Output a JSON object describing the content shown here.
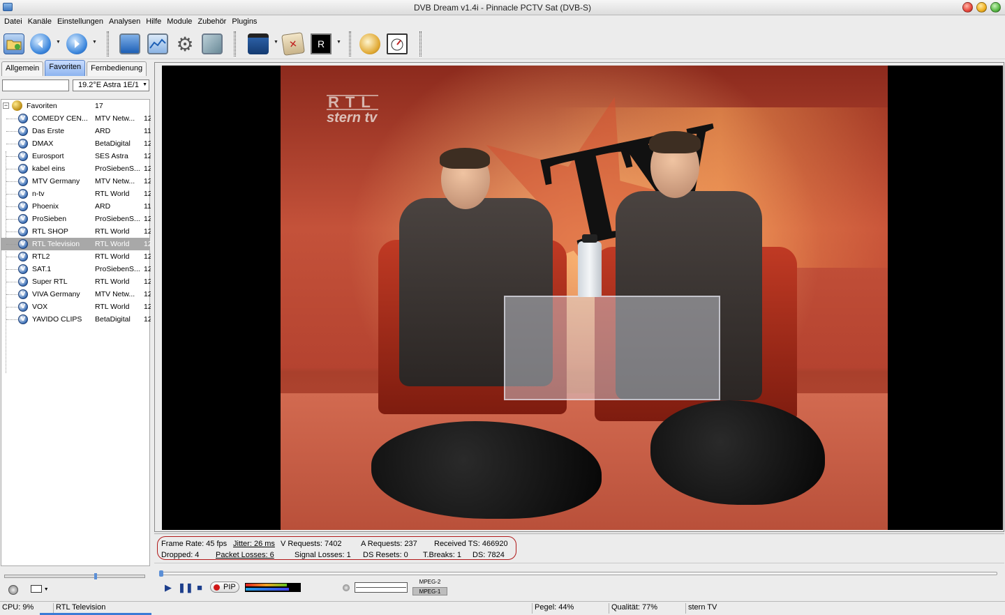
{
  "window": {
    "title": "DVB Dream v1.4i - Pinnacle PCTV Sat (DVB-S)",
    "controls": [
      "close",
      "minimize",
      "maximize"
    ],
    "control_colors": [
      "#e8463c",
      "#f0b020",
      "#56b844"
    ]
  },
  "menu": [
    "Datei",
    "Kanäle",
    "Einstellungen",
    "Analysen",
    "Hilfe",
    "Module",
    "Zubehör",
    "Plugins"
  ],
  "toolbar": {
    "icons": [
      "folder-icon",
      "back-icon",
      "forward-icon",
      "monitor-icon",
      "signal-graph-icon",
      "gear-icon",
      "screen-icon",
      "clapperboard-icon",
      "epg-icon",
      "record-icon",
      "stopwatch-icon",
      "calendar-icon"
    ]
  },
  "left_panel": {
    "tabs": [
      "Allgemein",
      "Favoriten",
      "Fernbedienung"
    ],
    "active_tab": "Favoriten",
    "search": {
      "value": "",
      "placeholder": ""
    },
    "satellite": "19.2°E Astra 1E/1",
    "group": {
      "name": "Favoriten",
      "count": "17"
    },
    "channels": [
      {
        "name": "COMEDY CEN...",
        "provider": "MTV Netw...",
        "extra": "12"
      },
      {
        "name": "Das Erste",
        "provider": "ARD",
        "extra": "11"
      },
      {
        "name": "DMAX",
        "provider": "BetaDigital",
        "extra": "12"
      },
      {
        "name": "Eurosport",
        "provider": "SES Astra",
        "extra": "12"
      },
      {
        "name": "kabel eins",
        "provider": "ProSiebenS...",
        "extra": "12"
      },
      {
        "name": "MTV Germany",
        "provider": "MTV Netw...",
        "extra": "12"
      },
      {
        "name": "n-tv",
        "provider": "RTL World",
        "extra": "12"
      },
      {
        "name": "Phoenix",
        "provider": "ARD",
        "extra": "11"
      },
      {
        "name": "ProSieben",
        "provider": "ProSiebenS...",
        "extra": "12"
      },
      {
        "name": "RTL SHOP",
        "provider": "RTL World",
        "extra": "12"
      },
      {
        "name": "RTL Television",
        "provider": "RTL World",
        "extra": "12",
        "selected": true
      },
      {
        "name": "RTL2",
        "provider": "RTL World",
        "extra": "12"
      },
      {
        "name": "SAT.1",
        "provider": "ProSiebenS...",
        "extra": "12"
      },
      {
        "name": "Super RTL",
        "provider": "RTL World",
        "extra": "12"
      },
      {
        "name": "VIVA Germany",
        "provider": "MTV Netw...",
        "extra": "12"
      },
      {
        "name": "VOX",
        "provider": "RTL World",
        "extra": "12"
      },
      {
        "name": "YAVIDO CLIPS",
        "provider": "BetaDigital",
        "extra": "12"
      }
    ]
  },
  "video": {
    "logo_line1": "RTL",
    "logo_line2": "stern tv",
    "set_text": "TV"
  },
  "stats": {
    "frame_rate": "Frame Rate: 45 fps",
    "jitter": "Jitter: 26 ms",
    "v_requests": "V Requests: 7402",
    "a_requests": "A Requests: 237",
    "received_ts": "Received TS: 466920",
    "dropped": "Dropped: 4",
    "packet_losses": "Packet Losses: 6",
    "signal_losses": "Signal Losses: 1",
    "ds_resets": "DS Resets: 0",
    "t_breaks": "T.Breaks: 1",
    "ds": "DS: 7824"
  },
  "transport": {
    "pip_label": "PIP",
    "codec1": "MPEG-2",
    "codec2": "MPEG-1",
    "meter_levels": [
      0.75,
      0.8
    ]
  },
  "statusbar": {
    "cpu": "CPU: 9%",
    "channel": "RTL Television",
    "pegel": "Pegel: 44%",
    "qualitaet": "Qualität: 77%",
    "program": "stern TV"
  }
}
